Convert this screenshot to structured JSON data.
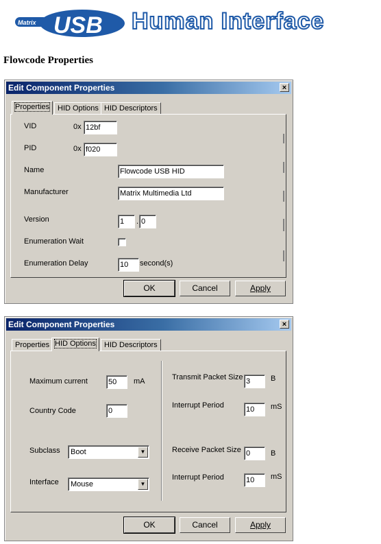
{
  "banner": {
    "logo_text": "USB",
    "logo_small_text": "Matrix",
    "title": "Human Interface"
  },
  "page": {
    "section_title": "Flowcode Properties"
  },
  "dialog1": {
    "title": "Edit Component Properties",
    "close_glyph": "×",
    "tabs": [
      "Properties",
      "HID Options",
      "HID Descriptors"
    ],
    "fields": {
      "vid": {
        "label": "VID",
        "prefix": "0x",
        "value": "12bf"
      },
      "pid": {
        "label": "PID",
        "prefix": "0x",
        "value": "f020"
      },
      "name": {
        "label": "Name",
        "value": "Flowcode USB HID"
      },
      "manufacturer": {
        "label": "Manufacturer",
        "value": "Matrix Multimedia Ltd"
      },
      "version": {
        "label": "Version",
        "major": "1",
        "separator": ".",
        "minor": "0"
      },
      "enum_wait": {
        "label": "Enumeration Wait",
        "checked": false
      },
      "enum_delay": {
        "label": "Enumeration Delay",
        "value": "10",
        "unit": "second(s)"
      }
    },
    "buttons": {
      "ok": "OK",
      "cancel": "Cancel",
      "apply": "Apply"
    }
  },
  "dialog2": {
    "title": "Edit Component Properties",
    "close_glyph": "×",
    "tabs": [
      "Properties",
      "HID Options",
      "HID Descriptors"
    ],
    "fields": {
      "max_current": {
        "label": "Maximum current",
        "value": "50",
        "unit": "mA"
      },
      "country_code": {
        "label": "Country Code",
        "value": "0"
      },
      "subclass": {
        "label": "Subclass",
        "value": "Boot"
      },
      "interface": {
        "label": "Interface",
        "value": "Mouse"
      },
      "tx_packet": {
        "label": "Transmit Packet Size",
        "value": "3",
        "unit": "B"
      },
      "tx_interrupt": {
        "label": "Interrupt Period",
        "value": "10",
        "unit": "mS"
      },
      "rx_packet": {
        "label": "Receive Packet Size",
        "value": "0",
        "unit": "B"
      },
      "rx_interrupt": {
        "label": "Interrupt Period",
        "value": "10",
        "unit": "mS"
      }
    },
    "buttons": {
      "ok": "OK",
      "cancel": "Cancel",
      "apply": "Apply"
    }
  },
  "icons": {
    "dropdown": "▼"
  },
  "colors": {
    "titlebar_start": "#0a246a",
    "titlebar_end": "#a6caf0",
    "dialog_bg": "#d4d0c8",
    "banner_blue": "#1f5aa8"
  }
}
